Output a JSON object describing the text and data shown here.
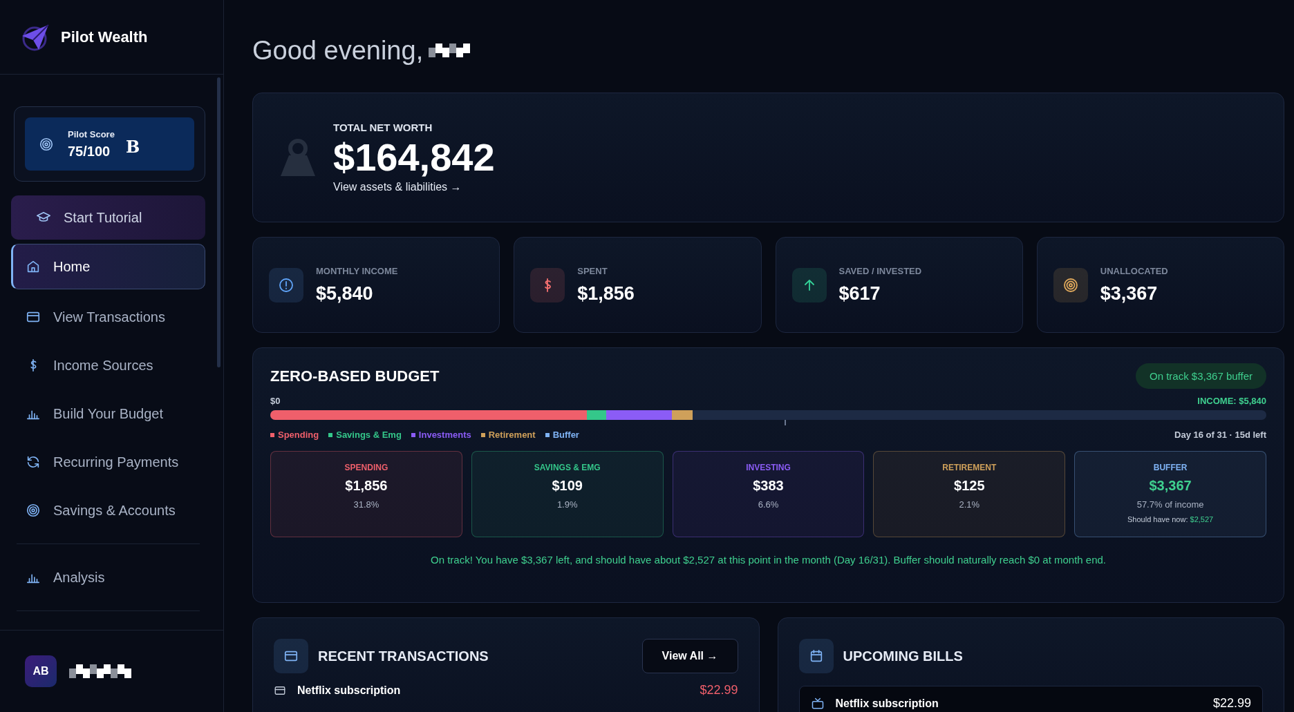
{
  "brand": {
    "name": "Pilot Wealth"
  },
  "score": {
    "label": "Pilot Score",
    "value": "75/100",
    "grade": "B"
  },
  "tutorial": {
    "label": "Start Tutorial"
  },
  "nav": [
    {
      "label": "Home",
      "selected": true
    },
    {
      "label": "View Transactions",
      "selected": false
    },
    {
      "label": "Income Sources",
      "selected": false
    },
    {
      "label": "Build Your Budget",
      "selected": false
    },
    {
      "label": "Recurring Payments",
      "selected": false
    },
    {
      "label": "Savings & Accounts",
      "selected": false
    },
    {
      "label": "Analysis",
      "selected": false
    }
  ],
  "user": {
    "initials": "AB"
  },
  "greeting": "Good evening,",
  "net_worth": {
    "label": "TOTAL NET WORTH",
    "value": "$164,842",
    "link": "View assets & liabilities →"
  },
  "stats": [
    {
      "label": "MONTHLY INCOME",
      "value": "$5,840",
      "color": "#60a5fa"
    },
    {
      "label": "SPENT",
      "value": "$1,856",
      "color": "#f87171"
    },
    {
      "label": "SAVED / INVESTED",
      "value": "$617",
      "color": "#34d399"
    },
    {
      "label": "UNALLOCATED",
      "value": "$3,367",
      "color": "#e0a95c"
    }
  ],
  "budget": {
    "title": "ZERO-BASED BUDGET",
    "badge": "On track $3,367 buffer",
    "start_label": "$0",
    "income_label": "INCOME: $5,840",
    "today_marker": {
      "level": 0.516
    },
    "day_label": "Day 16 of 31 · 15d left",
    "segments": [
      {
        "name": "Spending",
        "color": "#ef5f6b",
        "level": 0.318
      },
      {
        "name": "Savings & Emg",
        "color": "#34c78a"
      },
      {
        "name": "Investments",
        "color": "#8b5cf6"
      },
      {
        "name": "Retirement",
        "color": "#cfa05a"
      },
      {
        "name": "Buffer",
        "color": "#7fb3f5"
      }
    ],
    "cards": [
      {
        "label": "SPENDING",
        "value": "$1,856",
        "percent": "31.8%",
        "color": "#ef5f6b",
        "kind": "plain"
      },
      {
        "label": "SAVINGS & EMG",
        "value": "$109",
        "percent": "1.9%",
        "color": "#34c78a",
        "kind": "plain"
      },
      {
        "label": "INVESTING",
        "value": "$383",
        "percent": "6.6%",
        "color": "#8b5cf6",
        "kind": "plain"
      },
      {
        "label": "RETIREMENT",
        "value": "$125",
        "percent": "2.1%",
        "color": "#cfa05a",
        "kind": "plain"
      },
      {
        "label": "BUFFER",
        "value": "$3,367",
        "percent": "57.7% of income",
        "color": "#7fb3f5",
        "kind": "buffer",
        "note_label": "Should have now:",
        "note_value": "$2,527"
      }
    ],
    "message": "On track! You have $3,367 left, and should have about $2,527 at this point in the month (Day 16/31). Buffer should naturally reach $0 at month end."
  },
  "recent": {
    "title": "RECENT TRANSACTIONS",
    "button": "View All →",
    "rows": [
      {
        "name": "Netflix subscription",
        "amount": "$22.99"
      }
    ]
  },
  "bills": {
    "title": "UPCOMING BILLS",
    "rows": [
      {
        "name": "Netflix subscription",
        "amount": "$22.99"
      }
    ]
  }
}
